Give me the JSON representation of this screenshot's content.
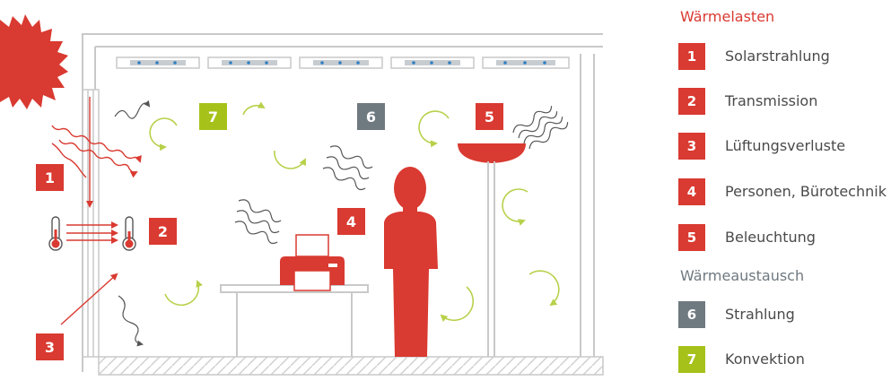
{
  "colors": {
    "red": "#d93a31",
    "gray": "#6f7980",
    "green": "#a6c21a",
    "structure": "#c9c9c9",
    "arrow_green": "#b7d14a",
    "dark": "#555555"
  },
  "legend": {
    "heading_loads": "Wärmelasten",
    "heading_exchange": "Wärmeaustausch",
    "items": [
      {
        "num": "1",
        "label": "Solarstrahlung",
        "color": "#d93a31"
      },
      {
        "num": "2",
        "label": "Transmission",
        "color": "#d93a31"
      },
      {
        "num": "3",
        "label": "Lüftungsverluste",
        "color": "#d93a31"
      },
      {
        "num": "4",
        "label": "Personen, Bürotechnik",
        "color": "#d93a31"
      },
      {
        "num": "5",
        "label": "Beleuchtung",
        "color": "#d93a31"
      },
      {
        "num": "6",
        "label": "Strahlung",
        "color": "#6f7980"
      },
      {
        "num": "7",
        "label": "Konvektion",
        "color": "#a6c21a"
      }
    ]
  },
  "badges": [
    {
      "num": "1",
      "color": "#d93a31"
    },
    {
      "num": "2",
      "color": "#d93a31"
    },
    {
      "num": "3",
      "color": "#d93a31"
    },
    {
      "num": "4",
      "color": "#d93a31"
    },
    {
      "num": "5",
      "color": "#d93a31"
    },
    {
      "num": "6",
      "color": "#6f7980"
    },
    {
      "num": "7",
      "color": "#a6c21a"
    }
  ],
  "icons": [
    "sun-icon",
    "thermometer-icon",
    "printer-icon",
    "person-icon",
    "floor-lamp-icon",
    "ceiling-light-icon",
    "heat-wave-icon",
    "convection-arrow-icon"
  ]
}
